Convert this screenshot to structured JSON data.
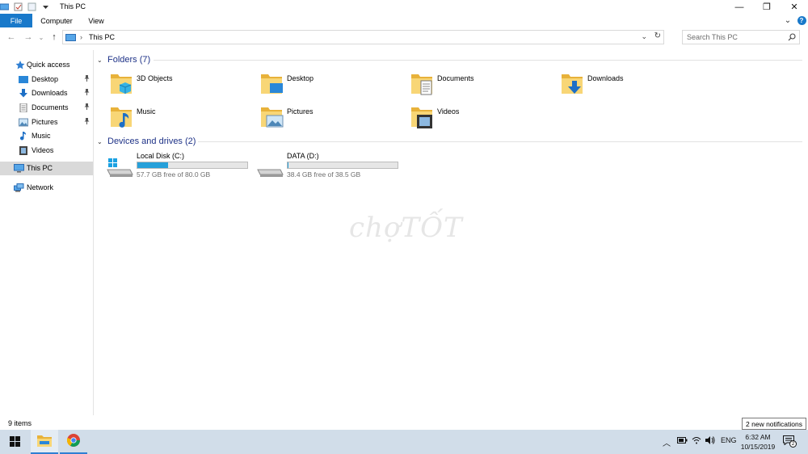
{
  "window": {
    "title": "This PC",
    "minimize_glyph": "—",
    "restore_glyph": "❐",
    "close_glyph": "✕",
    "expand_glyph": "⌄",
    "help_glyph": "?"
  },
  "ribbon": {
    "tabs": [
      "File",
      "Computer",
      "View"
    ]
  },
  "address": {
    "back_glyph": "←",
    "forward_glyph": "→",
    "recent_glyph": "⌄",
    "up_glyph": "↑",
    "separator": "›",
    "path": "This PC",
    "dropdown_glyph": "⌄",
    "refresh_glyph": "↻"
  },
  "search": {
    "placeholder": "Search This PC"
  },
  "navpane": {
    "quick_access": "Quick access",
    "pinned": [
      {
        "label": "Desktop",
        "icon": "desktop-icon"
      },
      {
        "label": "Downloads",
        "icon": "downloads-icon"
      },
      {
        "label": "Documents",
        "icon": "documents-icon"
      },
      {
        "label": "Pictures",
        "icon": "pictures-icon"
      },
      {
        "label": "Music",
        "icon": "music-icon"
      },
      {
        "label": "Videos",
        "icon": "videos-icon"
      }
    ],
    "pin_glyph": "📌",
    "this_pc": "This PC",
    "network": "Network"
  },
  "content": {
    "folders_header": "Folders (7)",
    "folders": [
      {
        "label": "3D Objects",
        "icon": "3d-objects-folder-icon"
      },
      {
        "label": "Desktop",
        "icon": "desktop-folder-icon"
      },
      {
        "label": "Documents",
        "icon": "documents-folder-icon"
      },
      {
        "label": "Downloads",
        "icon": "downloads-folder-icon"
      },
      {
        "label": "Music",
        "icon": "music-folder-icon"
      },
      {
        "label": "Pictures",
        "icon": "pictures-folder-icon"
      },
      {
        "label": "Videos",
        "icon": "videos-folder-icon"
      }
    ],
    "drives_header": "Devices and drives (2)",
    "drives": [
      {
        "label": "Local Disk (C:)",
        "free": "57.7 GB free of 80.0 GB",
        "used_fraction": 0.279
      },
      {
        "label": "DATA (D:)",
        "free": "38.4 GB free of 38.5 GB",
        "used_fraction": 0.003
      }
    ],
    "chevron_glyph": "⌄",
    "watermark": "chợTỐT"
  },
  "status": {
    "items": "9 items"
  },
  "taskbar": {
    "tray_up_glyph": "︿",
    "language": "ENG",
    "time": "6:32 AM",
    "date": "10/15/2019",
    "notification_count": "2",
    "notification_popup": "2 new notifications"
  },
  "colors": {
    "accent": "#1979ca",
    "drive_fill": "#26a0da",
    "folder_yellow": "#f3c64a",
    "taskbar": "#d1dde9"
  }
}
